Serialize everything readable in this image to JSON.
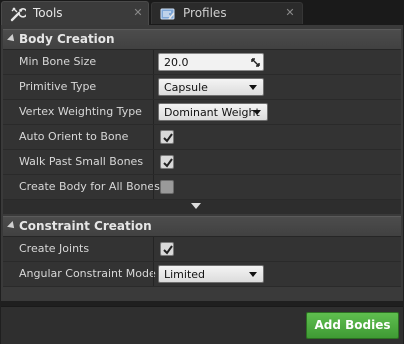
{
  "tabs": [
    {
      "label": "Tools",
      "icon": "wrench-icon",
      "close": "✕",
      "active": true
    },
    {
      "label": "Profiles",
      "icon": "profiles-icon",
      "close": "✕",
      "active": false
    }
  ],
  "body_creation": {
    "title": "Body Creation",
    "min_bone_size": {
      "label": "Min Bone Size",
      "value": "20.0"
    },
    "primitive_type": {
      "label": "Primitive Type",
      "value": "Capsule"
    },
    "vertex_weighting": {
      "label": "Vertex Weighting Type",
      "value": "Dominant Weight"
    },
    "auto_orient": {
      "label": "Auto Orient to Bone",
      "checked": true
    },
    "walk_past": {
      "label": "Walk Past Small Bones",
      "checked": true
    },
    "create_body_all": {
      "label": "Create Body for All Bones",
      "checked": false
    }
  },
  "constraint_creation": {
    "title": "Constraint Creation",
    "create_joints": {
      "label": "Create Joints",
      "checked": true
    },
    "angular_mode": {
      "label": "Angular Constraint Mode",
      "value": "Limited"
    }
  },
  "footer": {
    "add_bodies_label": "Add Bodies"
  },
  "colors": {
    "accent_green": "#4aa83d",
    "panel": "#3a3a3a",
    "header": "#474747"
  }
}
